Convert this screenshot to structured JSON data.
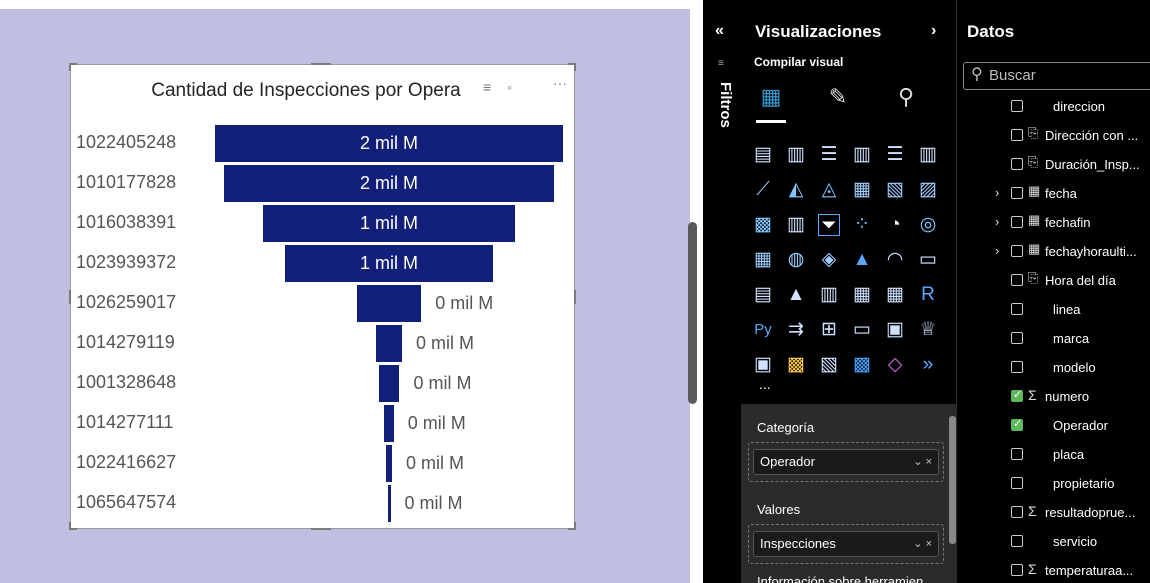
{
  "visual": {
    "title": "Cantidad de Inspecciones por Opera",
    "header_icons": [
      "filter-icon",
      "focus-mode-icon",
      "more-options-icon"
    ],
    "bar_color": "#12207a"
  },
  "chart_data": {
    "type": "funnel",
    "title": "Cantidad de Inspecciones por Opera",
    "categories": [
      "1022405248",
      "1010177828",
      "1016038391",
      "1023939372",
      "1026259017",
      "1014279119",
      "1001328648",
      "1014277111",
      "1022416627",
      "1065647574"
    ],
    "values": [
      2000000000,
      1900000000,
      1450000000,
      1200000000,
      370000000,
      150000000,
      120000000,
      55000000,
      35000000,
      12000000
    ],
    "labels": [
      "2 mil M",
      "2 mil M",
      "1 mil M",
      "1 mil M",
      "0 mil M",
      "0 mil M",
      "0 mil M",
      "0 mil M",
      "0 mil M",
      "0 mil M"
    ]
  },
  "filters_pane": {
    "label": "Filtros",
    "collapse_icon": "double-chevron-left-icon"
  },
  "viz_pane": {
    "title": "Visualizaciones",
    "expand_icon": "chevron-right-icon",
    "build_label": "Compilar visual",
    "tabs": [
      "build-visual-icon",
      "format-visual-icon",
      "analytics-icon"
    ],
    "more_label": "...",
    "wells": [
      {
        "title": "Categoría",
        "field": "Operador"
      },
      {
        "title": "Valores",
        "field": "Inspecciones"
      }
    ],
    "tooltip_well_title": "Información sobre herramien",
    "well_controls": "⌄ ×"
  },
  "data_pane": {
    "title": "Datos",
    "search_placeholder": "Buscar",
    "fields": [
      {
        "name": "direccion",
        "icon": "",
        "checked": false,
        "expand": false
      },
      {
        "name": "Dirección con ...",
        "icon": "calc-column-icon",
        "checked": false,
        "expand": false
      },
      {
        "name": "Duración_Insp...",
        "icon": "calc-column-icon",
        "checked": false,
        "expand": false
      },
      {
        "name": "fecha",
        "icon": "calendar-icon",
        "checked": false,
        "expand": true
      },
      {
        "name": "fechafin",
        "icon": "calendar-icon",
        "checked": false,
        "expand": true
      },
      {
        "name": "fechayhoraulti...",
        "icon": "calendar-icon",
        "checked": false,
        "expand": true
      },
      {
        "name": "Hora del día",
        "icon": "calc-column-icon",
        "checked": false,
        "expand": false
      },
      {
        "name": "linea",
        "icon": "",
        "checked": false,
        "expand": false
      },
      {
        "name": "marca",
        "icon": "",
        "checked": false,
        "expand": false
      },
      {
        "name": "modelo",
        "icon": "",
        "checked": false,
        "expand": false
      },
      {
        "name": "numero",
        "icon": "sigma-icon",
        "checked": true,
        "expand": false
      },
      {
        "name": "Operador",
        "icon": "",
        "checked": true,
        "expand": false
      },
      {
        "name": "placa",
        "icon": "",
        "checked": false,
        "expand": false
      },
      {
        "name": "propietario",
        "icon": "",
        "checked": false,
        "expand": false
      },
      {
        "name": "resultadoprue...",
        "icon": "sigma-icon",
        "checked": false,
        "expand": false
      },
      {
        "name": "servicio",
        "icon": "",
        "checked": false,
        "expand": false
      },
      {
        "name": "temperaturaa...",
        "icon": "sigma-icon",
        "checked": false,
        "expand": false
      }
    ]
  }
}
